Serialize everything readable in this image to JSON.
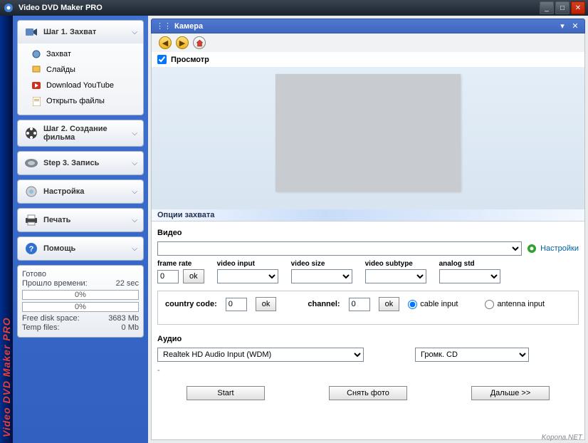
{
  "window": {
    "title": "Video DVD Maker PRO"
  },
  "brand": "Video DVD Maker PRO",
  "sidebar": {
    "step1": {
      "title": "Шаг 1. Захват",
      "items": [
        {
          "label": "Захват"
        },
        {
          "label": "Слайды"
        },
        {
          "label": "Download YouTube"
        },
        {
          "label": "Открыть файлы"
        }
      ]
    },
    "step2": {
      "title": "Шаг 2. Создание фильма"
    },
    "step3": {
      "title": "Step 3. Запись"
    },
    "settings": {
      "title": "Настройка"
    },
    "print": {
      "title": "Печать"
    },
    "help": {
      "title": "Помощь"
    }
  },
  "status": {
    "ready": "Готово",
    "elapsed_label": "Прошло времени:",
    "elapsed_value": "22 sec",
    "progress1": "0%",
    "progress2": "0%",
    "disk_label": "Free disk space:",
    "disk_value": "3683 Mb",
    "temp_label": "Temp files:",
    "temp_value": "0 Mb"
  },
  "panel": {
    "title": "Камера",
    "preview_check": "Просмотр",
    "capture_opts": "Опции захвата"
  },
  "video": {
    "heading": "Видео",
    "settings_link": "Настройки",
    "frame_rate_label": "frame rate",
    "frame_rate_value": "0",
    "ok": "ok",
    "video_input_label": "video input",
    "video_size_label": "video size",
    "video_subtype_label": "video subtype",
    "analog_std_label": "analog std",
    "country_code_label": "country code:",
    "country_code_value": "0",
    "channel_label": "channel:",
    "channel_value": "0",
    "cable_input": "cable input",
    "antenna_input": "antenna input"
  },
  "audio": {
    "heading": "Аудио",
    "device": "Realtek HD Audio Input (WDM)",
    "source": "Громк. CD",
    "dash": "-"
  },
  "buttons": {
    "start": "Start",
    "snapshot": "Снять фото",
    "next": "Дальше >>"
  },
  "watermark": "Kopona.NET"
}
